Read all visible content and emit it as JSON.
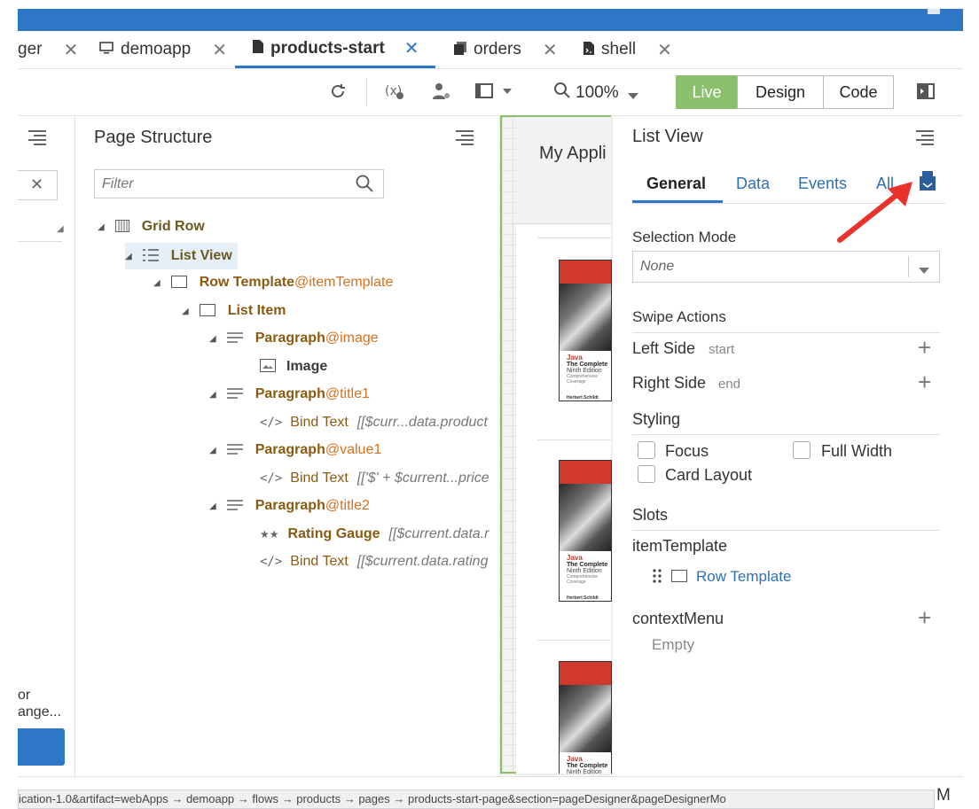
{
  "tabs": [
    {
      "label": "ger",
      "close": "✕"
    },
    {
      "label": "demoapp",
      "close": "✕",
      "icon": "monitor-icon"
    },
    {
      "label": "products-start",
      "close": "✕",
      "icon": "file-icon",
      "active": true
    },
    {
      "label": "orders",
      "close": "✕",
      "icon": "files-icon"
    },
    {
      "label": "shell",
      "close": "✕",
      "icon": "file-code-icon"
    }
  ],
  "toolbar": {
    "zoom": "100%",
    "live": "Live",
    "design": "Design",
    "code": "Code"
  },
  "left_panel": {
    "close": "✕",
    "text1": "or",
    "text2": "ange..."
  },
  "page_structure": {
    "title": "Page Structure",
    "filter_placeholder": "Filter",
    "tree": {
      "grid_row": "Grid Row",
      "list_view": "List View",
      "row_template": "Row Template",
      "row_template_slot": "@itemTemplate",
      "list_item": "List Item",
      "para1": "Paragraph",
      "para1_slot": "@image",
      "image": "Image",
      "para2": "Paragraph",
      "para2_slot": "@title1",
      "bind1": "Bind Text",
      "bind1_val": "[[$curr...data.product",
      "para3": "Paragraph",
      "para3_slot": "@value1",
      "bind2": "Bind Text",
      "bind2_val": "[['$' + $current...price",
      "para4": "Paragraph",
      "para4_slot": "@title2",
      "rating": "Rating Gauge",
      "rating_val": "[[$current.data.r",
      "bind3": "Bind Text",
      "bind3_val": "[[$current.data.rating"
    }
  },
  "canvas": {
    "app_title": "My Appli",
    "book": {
      "t1": "Java",
      "t2": "The Complete",
      "t3": "Ninth Edition",
      "t4": "Comprehensive Coverage",
      "author": "Herbert Schildt"
    }
  },
  "list_view": {
    "title": "List View",
    "tabs": {
      "general": "General",
      "data": "Data",
      "events": "Events",
      "all": "All"
    },
    "selection_mode_label": "Selection Mode",
    "selection_mode_value": "None",
    "swipe_actions": "Swipe Actions",
    "left_side": "Left Side",
    "left_side_hint": "start",
    "right_side": "Right Side",
    "right_side_hint": "end",
    "styling": "Styling",
    "focus": "Focus",
    "full_width": "Full Width",
    "card_layout": "Card Layout",
    "slots": "Slots",
    "item_template": "itemTemplate",
    "row_template": "Row Template",
    "context_menu": "contextMenu",
    "empty": "Empty"
  },
  "status_url": "ication-1.0&artifact=webApps → demoapp → flows → products → pages → products-start-page&section=pageDesigner&pageDesignerMo",
  "status_suffix": "M",
  "colors": {
    "accent": "#2d77c6",
    "live": "#8dc06c",
    "slot": "#d8701c",
    "arrow": "#e8322b"
  }
}
